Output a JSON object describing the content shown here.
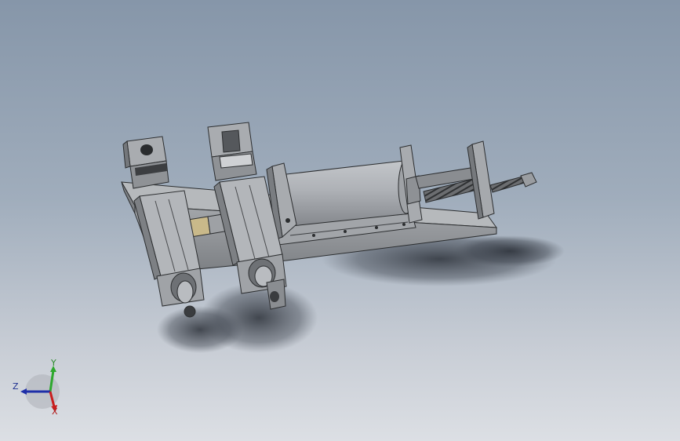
{
  "viewport": {
    "background_top": "#8696a9",
    "background_bottom": "#dcdfe4"
  },
  "triad": {
    "y_label": "Y",
    "z_label": "Z",
    "x_label": "X",
    "colors": {
      "x": "#c81e1e",
      "y": "#2ea82e",
      "z": "#1e2fa8"
    }
  }
}
